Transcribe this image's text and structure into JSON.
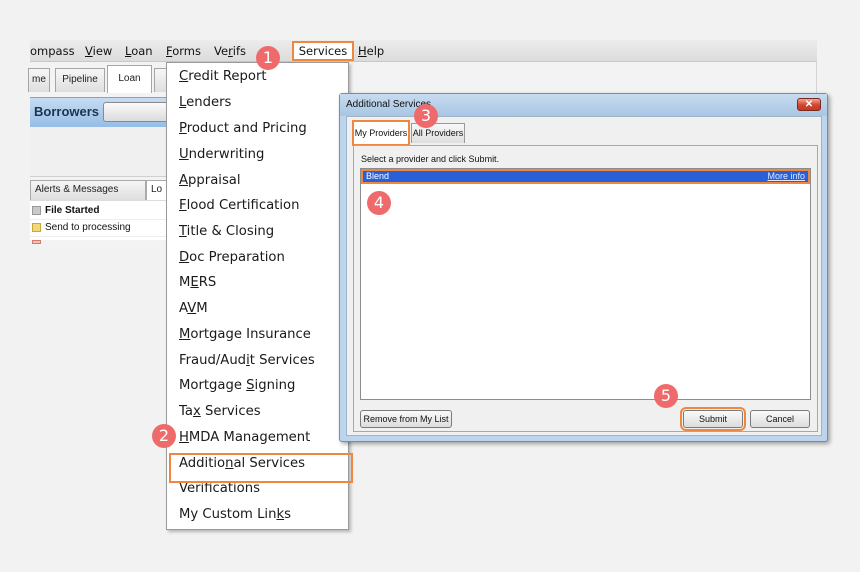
{
  "menubar": {
    "items": [
      {
        "label": "ompass",
        "underline": ""
      },
      {
        "label": "View",
        "underline": "V"
      },
      {
        "label": "Loan",
        "underline": "L"
      },
      {
        "label": "Forms",
        "underline": "F"
      },
      {
        "label": "Verifs",
        "underline": "r"
      },
      {
        "label": "Services",
        "underline": "S"
      },
      {
        "label": "Help",
        "underline": "H"
      }
    ]
  },
  "tabs": [
    {
      "label": "me"
    },
    {
      "label": "Pipeline"
    },
    {
      "label": "Loan",
      "active": true
    }
  ],
  "borrowers": {
    "label": "Borrowers"
  },
  "lower_tabs": [
    {
      "label": "Alerts & Messages"
    },
    {
      "label": "Lo",
      "active": true
    }
  ],
  "alerts": [
    {
      "label": "File Started",
      "bold": true,
      "icon": "gray-square-icon"
    },
    {
      "label": "Send to processing",
      "bold": false,
      "icon": "yellow-square-icon"
    }
  ],
  "services_menu": {
    "items": [
      {
        "pre": "",
        "u": "C",
        "post": "redit Report"
      },
      {
        "pre": "",
        "u": "L",
        "post": "enders"
      },
      {
        "pre": "",
        "u": "P",
        "post": "roduct and Pricing"
      },
      {
        "pre": "",
        "u": "U",
        "post": "nderwriting"
      },
      {
        "pre": "",
        "u": "A",
        "post": "ppraisal"
      },
      {
        "pre": "",
        "u": "F",
        "post": "lood Certification"
      },
      {
        "pre": "",
        "u": "T",
        "post": "itle & Closing"
      },
      {
        "pre": "",
        "u": "D",
        "post": "oc Preparation"
      },
      {
        "pre": "M",
        "u": "E",
        "post": "RS"
      },
      {
        "pre": "A",
        "u": "V",
        "post": "M"
      },
      {
        "pre": "",
        "u": "M",
        "post": "ortgage Insurance"
      },
      {
        "pre": "Fraud/Aud",
        "u": "i",
        "post": "t Services"
      },
      {
        "pre": "Mortgage ",
        "u": "S",
        "post": "igning"
      },
      {
        "pre": "Ta",
        "u": "x",
        "post": " Services"
      },
      {
        "pre": "",
        "u": "H",
        "post": "MDA Management"
      },
      {
        "pre": "Additio",
        "u": "n",
        "post": "al Services"
      },
      {
        "pre": "Verifications",
        "u": "",
        "post": ""
      },
      {
        "pre": "My Custom Lin",
        "u": "k",
        "post": "s"
      }
    ],
    "highlighted": "Additional Services"
  },
  "dialog": {
    "title": "Additional Services",
    "close_icon": "close-icon",
    "tabs": [
      {
        "label": "My Providers",
        "active": true
      },
      {
        "label": "All Providers"
      }
    ],
    "instruction": "Select a provider and click Submit.",
    "providers": [
      {
        "name": "Blend",
        "link": "More info",
        "selected": true
      }
    ],
    "buttons": {
      "remove": "Remove from My List",
      "submit": "Submit",
      "cancel": "Cancel"
    }
  },
  "steps": [
    "1",
    "2",
    "3",
    "4",
    "5"
  ],
  "colors": {
    "highlight_orange": "#f0873e",
    "badge_red": "#ef6b6b",
    "selection_blue": "#2860d8"
  }
}
